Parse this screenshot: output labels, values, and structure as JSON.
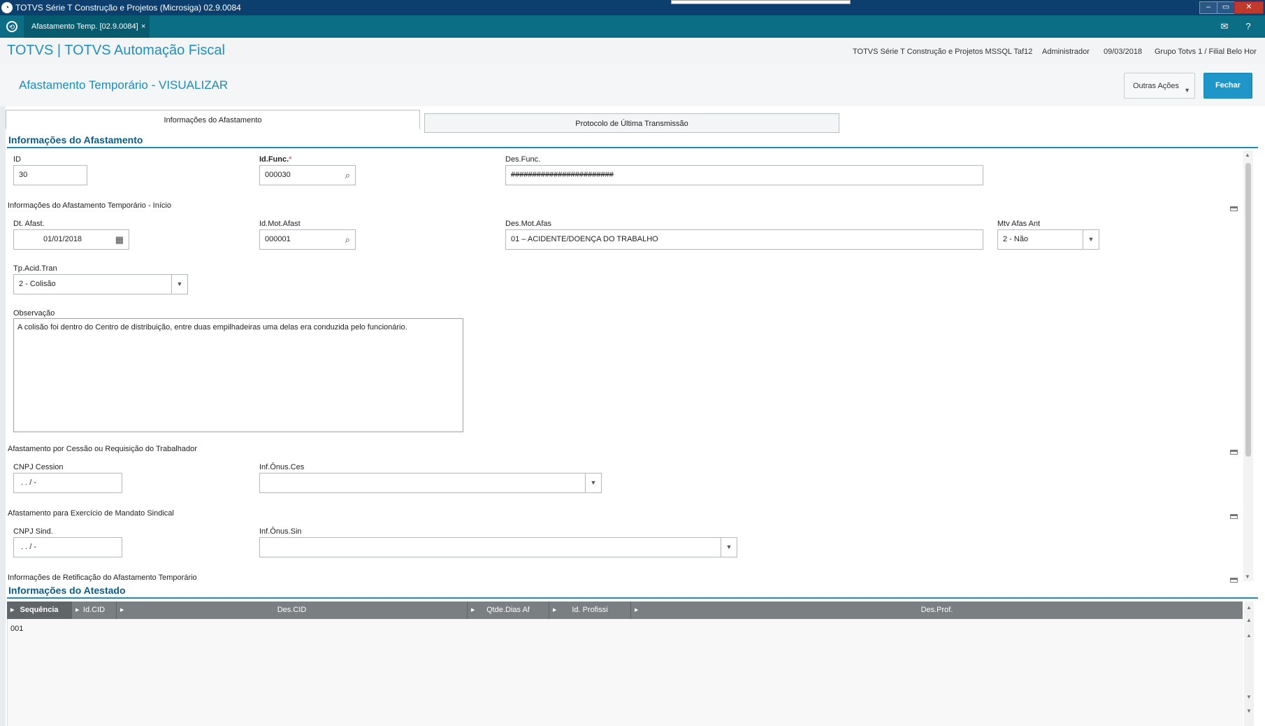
{
  "window": {
    "title": "TOTVS Série T Construção e Projetos (Microsiga) 02.9.0084"
  },
  "tabs": {
    "active_label": "Afastamento Temp. [02.9.0084]",
    "close": "×"
  },
  "appbar": {
    "app_name": "TOTVS | TOTVS Automação Fiscal",
    "environment": "TOTVS Série T Construção e Projetos MSSQL Taf12",
    "user": "Administrador",
    "date": "09/03/2018",
    "branch": "Grupo Totvs 1 / Filial Belo Hor"
  },
  "page": {
    "title": "Afastamento Temporário - VISUALIZAR",
    "other_actions": "Outras Ações",
    "close_button": "Fechar"
  },
  "form_tabs": [
    "Informações do Afastamento",
    "Protocolo de Última Transmissão"
  ],
  "section1": {
    "title": "Informações do Afastamento",
    "fields": {
      "id": {
        "label": "ID",
        "value": "30"
      },
      "id_func": {
        "label": "Id.Func.",
        "required": "*",
        "value": "000030"
      },
      "des_func": {
        "label": "Des.Func.",
        "value": "########################"
      }
    },
    "group_inicio": {
      "title": "Informações do Afastamento Temporário - Início",
      "dt_afast": {
        "label": "Dt. Afast.",
        "value": "01/01/2018"
      },
      "id_mot_afast": {
        "label": "Id.Mot.Afast",
        "value": "000001"
      },
      "des_mot_afas": {
        "label": "Des.Mot.Afas",
        "value": "01 – ACIDENTE/DOENÇA DO TRABALHO"
      },
      "mtv_afas_ant": {
        "label": "Mtv Afas Ant",
        "value": "2 - Não"
      },
      "tp_acid_tran": {
        "label": "Tp.Acid.Tran",
        "value": "2 - Colisão"
      },
      "observacao": {
        "label": "Observação",
        "value": "A colisão foi dentro do Centro de distribuição, entre duas empilhadeiras uma delas era conduzida pelo funcionário."
      }
    },
    "group_cessao": {
      "title": "Afastamento por Cessão ou Requisição do Trabalhador",
      "cnpj_cession": {
        "label": "CNPJ Cession",
        "value": " .  .  /  -"
      },
      "inf_onus_ces": {
        "label": "Inf.Ônus.Ces",
        "value": ""
      }
    },
    "group_sindical": {
      "title": "Afastamento para Exercício de Mandato Sindical",
      "cnpj_sind": {
        "label": "CNPJ Sind.",
        "value": " .  .  /  -"
      },
      "inf_onus_sin": {
        "label": "Inf.Ônus.Sin",
        "value": ""
      }
    },
    "group_retificacao": {
      "title": "Informações de Retificação do Afastamento Temporário"
    }
  },
  "section2": {
    "title": "Informações do Atestado",
    "columns": [
      "Sequência",
      "Id.CID",
      "Des.CID",
      "Qtde.Dias Af",
      "Id. Profissi",
      "Des.Prof."
    ],
    "rows": [
      [
        "001",
        "",
        "",
        "",
        "",
        ""
      ]
    ]
  },
  "colors": {
    "accent": "#1f96c8",
    "title_bar": "#0d3f6e",
    "tab_bar": "#0b6e85",
    "required": "#e0301e"
  }
}
